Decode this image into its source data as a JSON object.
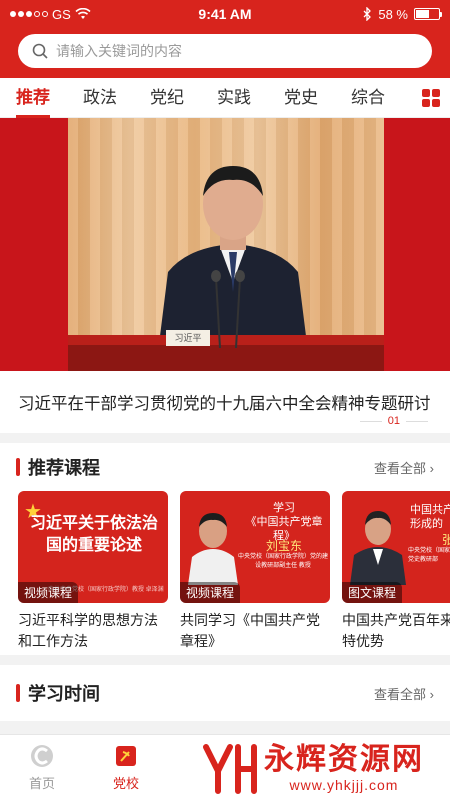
{
  "status_bar": {
    "carrier": "GS",
    "time": "9:41 AM",
    "battery": "58 %",
    "battery_level": 0.58
  },
  "search": {
    "placeholder": "请输入关键词的内容"
  },
  "tabs": [
    {
      "label": "推荐",
      "active": true
    },
    {
      "label": "政法",
      "active": false
    },
    {
      "label": "党纪",
      "active": false
    },
    {
      "label": "实践",
      "active": false
    },
    {
      "label": "党史",
      "active": false
    },
    {
      "label": "综合",
      "active": false
    }
  ],
  "banner": {
    "nameplate": "习近平",
    "headline": "习近平在干部学习贯彻党的十九届六中全会精神专题研讨",
    "page_indicator": "01"
  },
  "recommended": {
    "title": "推荐课程",
    "more": "查看全部",
    "courses": [
      {
        "thumb_title": "习近平关于依法治国的重要论述",
        "thumb_sub": "中共中央党校（国家行政学院）教授 卓泽渊",
        "badge": "视频课程",
        "title": "习近平科学的思想方法和工作方法"
      },
      {
        "thumb_title_1": "学习",
        "thumb_title_2": "《中国共产党章程》",
        "thumb_name": "刘宝东",
        "thumb_sub": "中央党校（国家行政学院）党的建设教研部副主任 教授",
        "badge": "视频课程",
        "title": "共同学习《中国共产党章程》"
      },
      {
        "thumb_title_1": "中国共产",
        "thumb_title_2": "形成的",
        "thumb_name": "张",
        "thumb_sub": "中央党校（国家行政学院）中共党史教研部",
        "badge": "图文课程",
        "title": "中国共产党百年来的独特优势"
      }
    ]
  },
  "study_time": {
    "title": "学习时间",
    "more": "查看全部"
  },
  "tabbar": [
    {
      "label": "首页",
      "icon": "home-logo-icon",
      "active": false
    },
    {
      "label": "党校",
      "icon": "party-school-flag-icon",
      "active": true
    }
  ],
  "watermark": {
    "brand": "永辉资源网",
    "url": "www.yhkjjj.com"
  },
  "colors": {
    "primary": "#d8241d",
    "text": "#222222",
    "muted": "#999999"
  }
}
